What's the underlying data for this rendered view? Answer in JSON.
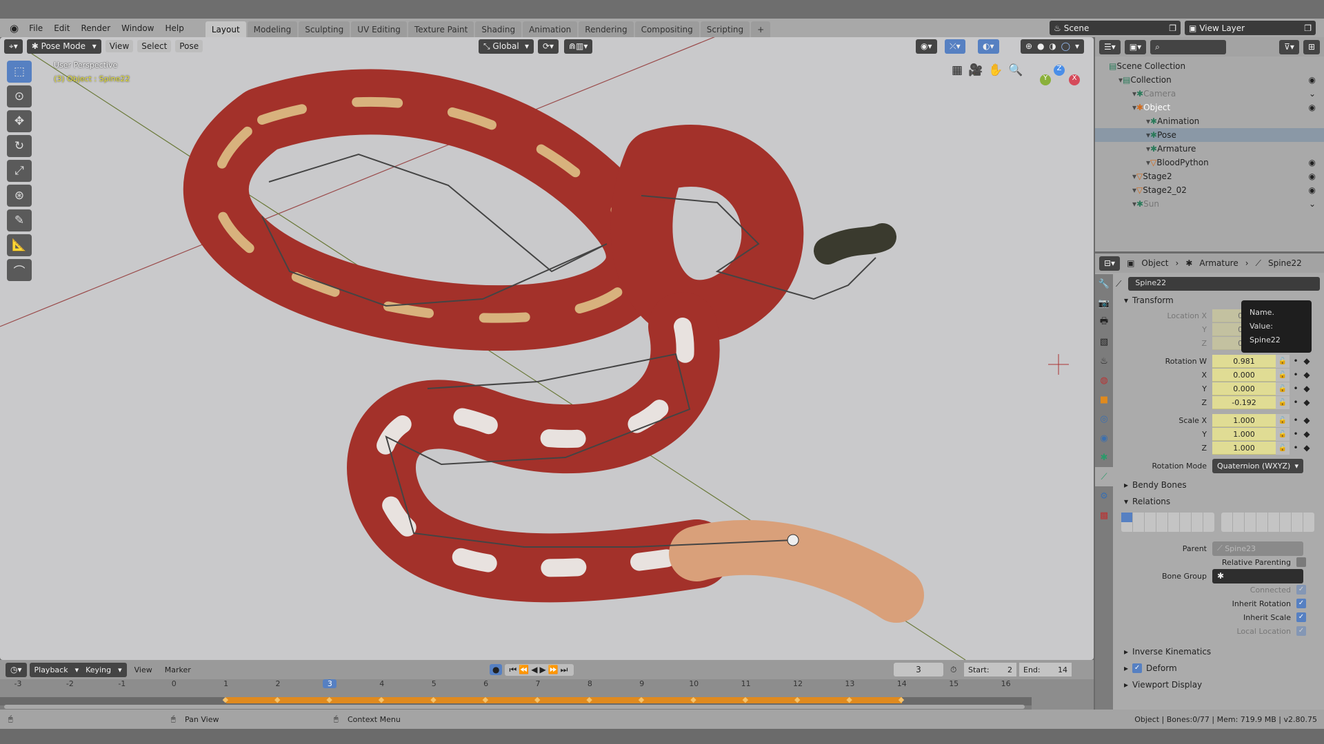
{
  "menubar": {
    "items": [
      "File",
      "Edit",
      "Render",
      "Window",
      "Help"
    ],
    "workspaces": [
      "Layout",
      "Modeling",
      "Sculpting",
      "UV Editing",
      "Texture Paint",
      "Shading",
      "Animation",
      "Rendering",
      "Compositing",
      "Scripting"
    ],
    "add": "+",
    "scene": "Scene",
    "view_layer": "View Layer"
  },
  "viewport": {
    "mode": "Pose Mode",
    "menus": [
      "View",
      "Select",
      "Pose"
    ],
    "orientation": "Global",
    "perspective": "User Perspective",
    "object_info": "(3) Object : Spine22",
    "gizmo": {
      "x": "X",
      "y": "Y",
      "z": "Z"
    }
  },
  "outliner": {
    "rows": [
      {
        "label": "Scene Collection",
        "depth": 0,
        "icon": "collection-icon"
      },
      {
        "label": "Collection",
        "depth": 1,
        "icon": "collection-icon",
        "eye": true
      },
      {
        "label": "Camera",
        "depth": 2,
        "icon": "camera-icon",
        "dim": true
      },
      {
        "label": "Object",
        "depth": 2,
        "icon": "armature-object-icon",
        "eye": true,
        "active": true
      },
      {
        "label": "Animation",
        "depth": 3,
        "icon": "animation-icon"
      },
      {
        "label": "Pose",
        "depth": 3,
        "icon": "pose-icon",
        "selected": true
      },
      {
        "label": "Armature",
        "depth": 3,
        "icon": "armature-data-icon"
      },
      {
        "label": "BloodPython",
        "depth": 3,
        "icon": "mesh-object-icon",
        "eye": true
      },
      {
        "label": "Stage2",
        "depth": 2,
        "icon": "mesh-object-icon",
        "eye": true
      },
      {
        "label": "Stage2_02",
        "depth": 2,
        "icon": "mesh-object-icon",
        "eye": true
      },
      {
        "label": "Sun",
        "depth": 2,
        "icon": "light-icon",
        "dim": true
      }
    ]
  },
  "properties": {
    "breadcrumb": [
      "Object",
      "Armature",
      "Spine22"
    ],
    "bone_name": "Spine22",
    "tooltip": {
      "title": "Name.",
      "value": "Value: Spine22"
    },
    "transform_label": "Transform",
    "rows": [
      {
        "label": "Location X",
        "value": "0m",
        "dim": true
      },
      {
        "label": "Y",
        "value": "0m",
        "dim": true
      },
      {
        "label": "Z",
        "value": "0m",
        "dim": true
      },
      {
        "label": "Rotation W",
        "value": "0.981"
      },
      {
        "label": "X",
        "value": "0.000"
      },
      {
        "label": "Y",
        "value": "0.000"
      },
      {
        "label": "Z",
        "value": "-0.192"
      },
      {
        "label": "Scale X",
        "value": "1.000"
      },
      {
        "label": "Y",
        "value": "1.000"
      },
      {
        "label": "Z",
        "value": "1.000"
      }
    ],
    "rotation_mode_label": "Rotation Mode",
    "rotation_mode": "Quaternion (WXYZ)",
    "bendy_bones": "Bendy Bones",
    "relations": "Relations",
    "parent_label": "Parent",
    "parent": "Spine23",
    "relative_parenting": "Relative Parenting",
    "bone_group": "Bone Group",
    "checks": [
      {
        "label": "Connected",
        "checked": true,
        "dim": true
      },
      {
        "label": "Inherit Rotation",
        "checked": true
      },
      {
        "label": "Inherit Scale",
        "checked": true
      },
      {
        "label": "Local Location",
        "checked": true,
        "dim": true
      }
    ],
    "inverse_kinematics": "Inverse Kinematics",
    "deform": "Deform",
    "viewport_display": "Viewport Display"
  },
  "timeline": {
    "menus": [
      "Playback",
      "Keying",
      "View",
      "Marker"
    ],
    "current_frame": "3",
    "start_label": "Start:",
    "start": "2",
    "end_label": "End:",
    "end": "14",
    "ticks": [
      "-3",
      "-2",
      "-1",
      "0",
      "1",
      "2",
      "3",
      "4",
      "5",
      "6",
      "7",
      "8",
      "9",
      "10",
      "11",
      "12",
      "13",
      "14",
      "15",
      "16"
    ],
    "keyframes": [
      1,
      2,
      3,
      4,
      5,
      6,
      7,
      8,
      9,
      10,
      11,
      12,
      13,
      14
    ]
  },
  "status": {
    "pan": "Pan View",
    "context": "Context Menu",
    "info": "Object | Bones:0/77 | Mem: 719.9 MB | v2.80.75"
  },
  "colors": {
    "accent": "#5680c2",
    "keyframe": "#e08a1e",
    "snake_red": "#a3312a"
  }
}
